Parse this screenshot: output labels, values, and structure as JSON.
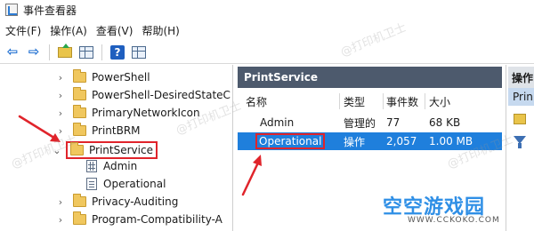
{
  "window": {
    "title": "事件查看器"
  },
  "menu": [
    {
      "label": "文件(F)"
    },
    {
      "label": "操作(A)"
    },
    {
      "label": "查看(V)"
    },
    {
      "label": "帮助(H)"
    }
  ],
  "toolbar": {
    "buttons": [
      {
        "icon": "back-arrow-icon",
        "glyph": "⇦"
      },
      {
        "icon": "forward-arrow-icon",
        "glyph": "⇨"
      },
      {
        "icon": "folder-up-icon"
      },
      {
        "icon": "show-hide-tree-icon"
      },
      {
        "icon": "help-icon",
        "glyph": "?"
      },
      {
        "icon": "show-hide-action-pane-icon"
      }
    ]
  },
  "tree": {
    "items": [
      {
        "label": "PowerShell",
        "expanded": false
      },
      {
        "label": "PowerShell-DesiredStateC",
        "expanded": false
      },
      {
        "label": "PrimaryNetworkIcon",
        "expanded": false
      },
      {
        "label": "PrintBRM",
        "expanded": false
      },
      {
        "label": "PrintService",
        "expanded": true,
        "selected": true
      },
      {
        "label": "Admin",
        "child": true
      },
      {
        "label": "Operational",
        "child": true
      },
      {
        "label": "Privacy-Auditing",
        "expanded": false
      },
      {
        "label": "Program-Compatibility-A",
        "expanded": false
      }
    ]
  },
  "content": {
    "header": "PrintService",
    "columns": [
      "名称",
      "类型",
      "事件数",
      "大小"
    ],
    "rows": [
      {
        "name": "Admin",
        "type": "管理的",
        "count": "77",
        "size": "68 KB",
        "selected": false
      },
      {
        "name": "Operational",
        "type": "操作",
        "count": "2,057",
        "size": "1.00 MB",
        "selected": true
      }
    ]
  },
  "actions": {
    "header": "操作",
    "subheader": "Prin"
  },
  "watermark": {
    "text": "@打印机卫士",
    "brand": "空空游戏园",
    "url": "WWW.CCKOKO.COM"
  },
  "colors": {
    "selection": "#1f7fdc",
    "pane_header": "#4d5a6d",
    "annotation_red": "#e0242b"
  }
}
